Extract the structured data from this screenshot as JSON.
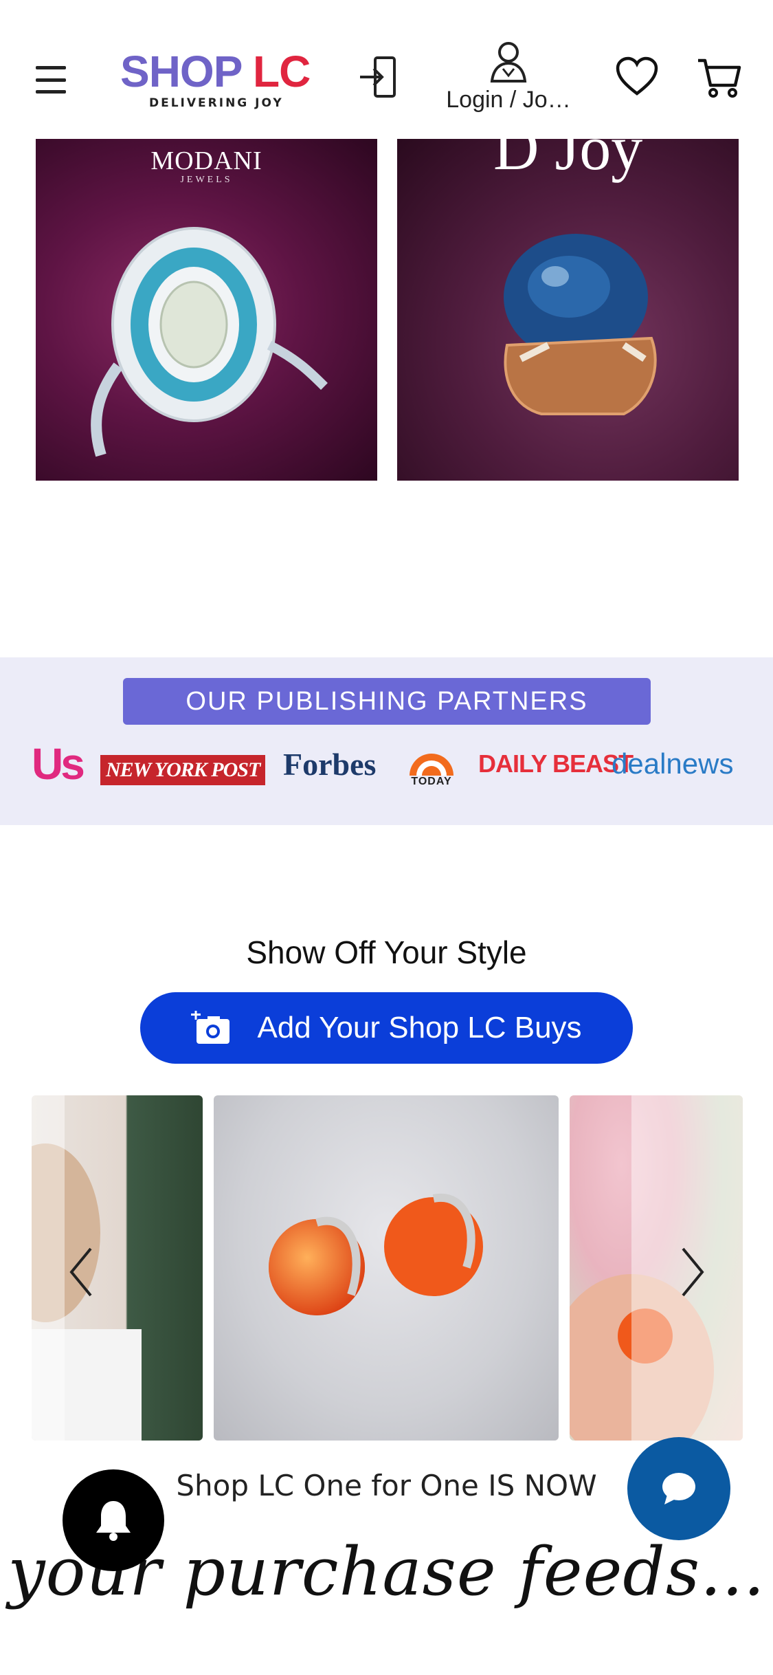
{
  "header": {
    "logo_main_a": "SHOP",
    "logo_main_b": "LC",
    "logo_tagline": "DELIVERING JOY",
    "user_label": "Login / Jo…",
    "icons": [
      "menu-icon",
      "login-icon",
      "user-icon",
      "heart-icon",
      "cart-icon"
    ]
  },
  "tiles": [
    {
      "brand": "MODANI",
      "brand_sub": "JEWELS"
    },
    {
      "partial_text": "D Joy"
    }
  ],
  "partners": {
    "title": "OUR PUBLISHING PARTNERS",
    "logos": [
      "Us",
      "NEW YORK POST",
      "Forbes",
      "TODAY",
      "DAILY BEAST",
      "dealnews"
    ]
  },
  "show_off": {
    "title": "Show Off Your Style",
    "button_label": "Add Your Shop LC Buys"
  },
  "one_for_one": "Shop LC One for One IS NOW",
  "feeds_text": "your purchase feeds...",
  "colors": {
    "brand_purple": "#6f63c7",
    "brand_red": "#e0253f",
    "cta_blue": "#0b3ed9",
    "chat_blue": "#0b5aa2",
    "partners_bg": "#ececf8"
  }
}
